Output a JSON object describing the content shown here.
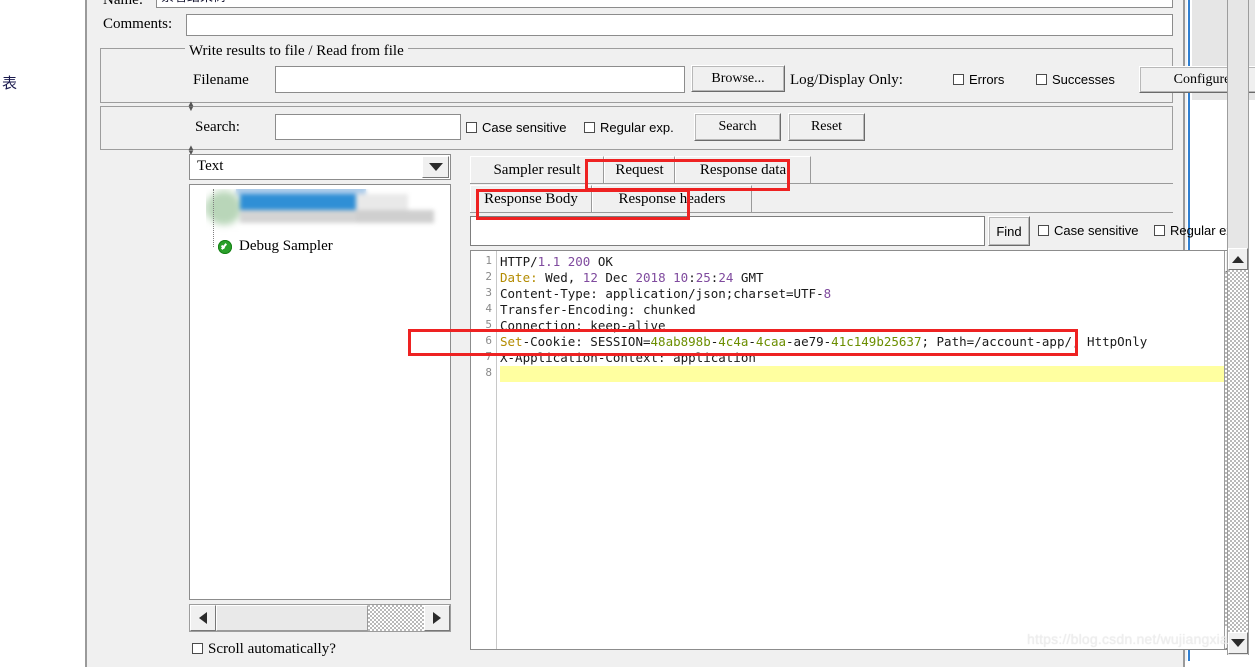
{
  "window": {
    "outside_text": "表"
  },
  "form": {
    "name_label": "Name:",
    "name_value": "察看结果树",
    "comments_label": "Comments:",
    "comments_value": ""
  },
  "write_results_group": {
    "title": "Write results to file / Read from file",
    "filename_label": "Filename",
    "filename_value": "",
    "filename_placeholder": "",
    "browse_button": "Browse...",
    "logdisplay_label": "Log/Display Only:",
    "errors_checkbox": "Errors",
    "errors_checked": false,
    "successes_checkbox": "Successes",
    "successes_checked": false,
    "configure_button": "Configure"
  },
  "search_bar": {
    "label": "Search:",
    "value": "",
    "case_sensitive_label": "Case sensitive",
    "case_sensitive_checked": false,
    "regular_exp_label": "Regular exp.",
    "regular_exp_checked": false,
    "search_button": "Search",
    "reset_button": "Reset"
  },
  "left_panel": {
    "render_combo_value": "Text",
    "combo_arrow_icon": "chevron-down-icon",
    "tree_items": [
      {
        "label": "",
        "status_icon": "success-icon",
        "blurred": true
      },
      {
        "label": "Debug Sampler",
        "status_icon": "success-icon",
        "blurred": false
      }
    ],
    "scroll_automatically_label": "Scroll automatically?",
    "scroll_automatically_checked": false,
    "hscroll_left_icon": "triangle-left-icon",
    "hscroll_right_icon": "triangle-right-icon"
  },
  "result_tabs": {
    "primary": [
      {
        "label": "Sampler result",
        "selected": false
      },
      {
        "label": "Request",
        "selected": false
      },
      {
        "label": "Response data",
        "selected": true,
        "highlighted": true
      }
    ],
    "secondary": [
      {
        "label": "Response Body",
        "selected": false
      },
      {
        "label": "Response headers",
        "selected": true,
        "highlighted": true
      }
    ]
  },
  "find_bar": {
    "value": "",
    "find_button": "Find",
    "case_sensitive_label": "Case sensitive",
    "case_sensitive_checked": false,
    "regular_exp_label": "Regular exp.",
    "regular_exp_checked": false
  },
  "response": {
    "line_numbers": [
      "1",
      "2",
      "3",
      "4",
      "5",
      "6",
      "7",
      "8"
    ],
    "lines": [
      {
        "n": "1",
        "segments": [
          {
            "t": "HTTP/",
            "c": "plain"
          },
          {
            "t": "1.1",
            "c": "num"
          },
          {
            "t": " ",
            "c": "plain"
          },
          {
            "t": "200",
            "c": "num"
          },
          {
            "t": " OK",
            "c": "plain"
          }
        ]
      },
      {
        "n": "2",
        "segments": [
          {
            "t": "Date:",
            "c": "date"
          },
          {
            "t": " Wed, ",
            "c": "plain"
          },
          {
            "t": "12",
            "c": "num"
          },
          {
            "t": " Dec ",
            "c": "plain"
          },
          {
            "t": "2018",
            "c": "num"
          },
          {
            "t": " ",
            "c": "plain"
          },
          {
            "t": "10",
            "c": "num"
          },
          {
            "t": ":",
            "c": "plain"
          },
          {
            "t": "25",
            "c": "num"
          },
          {
            "t": ":",
            "c": "plain"
          },
          {
            "t": "24",
            "c": "num"
          },
          {
            "t": " GMT",
            "c": "plain"
          }
        ]
      },
      {
        "n": "3",
        "segments": [
          {
            "t": "Content-Type: application/json;charset=UTF-",
            "c": "plain"
          },
          {
            "t": "8",
            "c": "num"
          }
        ]
      },
      {
        "n": "4",
        "segments": [
          {
            "t": "Transfer-Encoding: chunked",
            "c": "plain"
          }
        ]
      },
      {
        "n": "5",
        "segments": [
          {
            "t": "Connection: keep-alive",
            "c": "plain"
          }
        ]
      },
      {
        "n": "6",
        "segments": [
          {
            "t": "Set",
            "c": "date"
          },
          {
            "t": "-Cookie: SESSION=",
            "c": "plain"
          },
          {
            "t": "48ab898b",
            "c": "green"
          },
          {
            "t": "-",
            "c": "plain"
          },
          {
            "t": "4c4a",
            "c": "green"
          },
          {
            "t": "-",
            "c": "plain"
          },
          {
            "t": "4caa",
            "c": "green"
          },
          {
            "t": "-ae79-",
            "c": "plain"
          },
          {
            "t": "41c149b25637",
            "c": "green"
          },
          {
            "t": "; Path=/account-app/; HttpOnly",
            "c": "plain"
          }
        ]
      },
      {
        "n": "7",
        "segments": [
          {
            "t": "X-Application-Context: application",
            "c": "plain"
          }
        ]
      },
      {
        "n": "8",
        "segments": [
          {
            "t": "",
            "c": "plain"
          }
        ],
        "highlighted": true
      }
    ],
    "scrollbar_up_icon": "triangle-up-icon",
    "scrollbar_down_icon": "triangle-down-icon"
  },
  "annotations": {
    "boxes": [
      {
        "target": "Response data",
        "color": "#ee2222"
      },
      {
        "target": "Response headers",
        "color": "#ee2222"
      },
      {
        "target": "Set-Cookie line",
        "color": "#ee2222"
      }
    ]
  },
  "watermark": {
    "text": "https://blog.csdn.net/wujiangxia"
  }
}
